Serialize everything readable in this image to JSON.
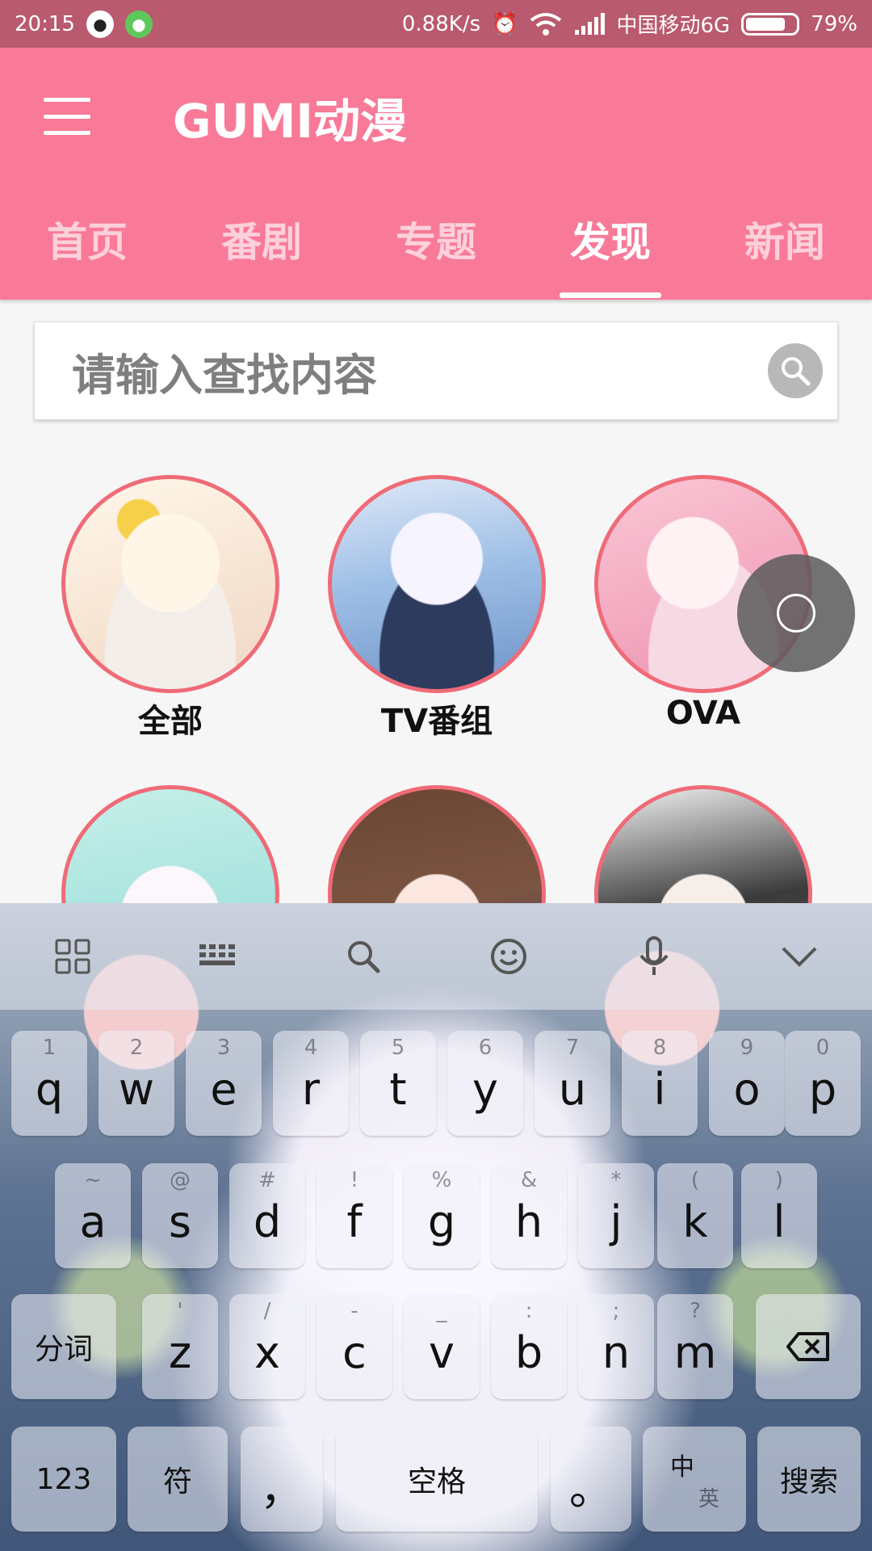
{
  "status_bar": {
    "time": "20:15",
    "net_speed": "0.88K/s",
    "carrier": "中国移动6G",
    "battery": "79%",
    "battery_level": 0.79
  },
  "app": {
    "title": "GUMI动漫"
  },
  "tabs": [
    {
      "label": "首页"
    },
    {
      "label": "番剧"
    },
    {
      "label": "专题"
    },
    {
      "label": "发现"
    },
    {
      "label": "新闻"
    }
  ],
  "active_tab": "发现",
  "search": {
    "placeholder": "请输入查找内容"
  },
  "categories": [
    {
      "label": "全部"
    },
    {
      "label": "TV番组"
    },
    {
      "label": "OVA"
    },
    {
      "label": ""
    },
    {
      "label": ""
    },
    {
      "label": ""
    }
  ],
  "keyboard": {
    "row1": [
      {
        "key": "q",
        "sub": "1"
      },
      {
        "key": "w",
        "sub": "2"
      },
      {
        "key": "e",
        "sub": "3"
      },
      {
        "key": "r",
        "sub": "4"
      },
      {
        "key": "t",
        "sub": "5"
      },
      {
        "key": "y",
        "sub": "6"
      },
      {
        "key": "u",
        "sub": "7"
      },
      {
        "key": "i",
        "sub": "8"
      },
      {
        "key": "o",
        "sub": "9"
      },
      {
        "key": "p",
        "sub": "0"
      }
    ],
    "row2": [
      {
        "key": "a",
        "sub": "~"
      },
      {
        "key": "s",
        "sub": "@"
      },
      {
        "key": "d",
        "sub": "#"
      },
      {
        "key": "f",
        "sub": "!"
      },
      {
        "key": "g",
        "sub": "%"
      },
      {
        "key": "h",
        "sub": "&"
      },
      {
        "key": "j",
        "sub": "*"
      },
      {
        "key": "k",
        "sub": "("
      },
      {
        "key": "l",
        "sub": ")"
      }
    ],
    "row3": [
      {
        "key": "z",
        "sub": "'"
      },
      {
        "key": "x",
        "sub": "/"
      },
      {
        "key": "c",
        "sub": "-"
      },
      {
        "key": "v",
        "sub": "_"
      },
      {
        "key": "b",
        "sub": ":"
      },
      {
        "key": "n",
        "sub": ";"
      },
      {
        "key": "m",
        "sub": "?"
      }
    ],
    "fenci": "分词",
    "num": "123",
    "symbol": "符",
    "comma": "，",
    "space": "空格",
    "period": "。",
    "lang_main": "中",
    "lang_sub": "英",
    "search": "搜索"
  }
}
